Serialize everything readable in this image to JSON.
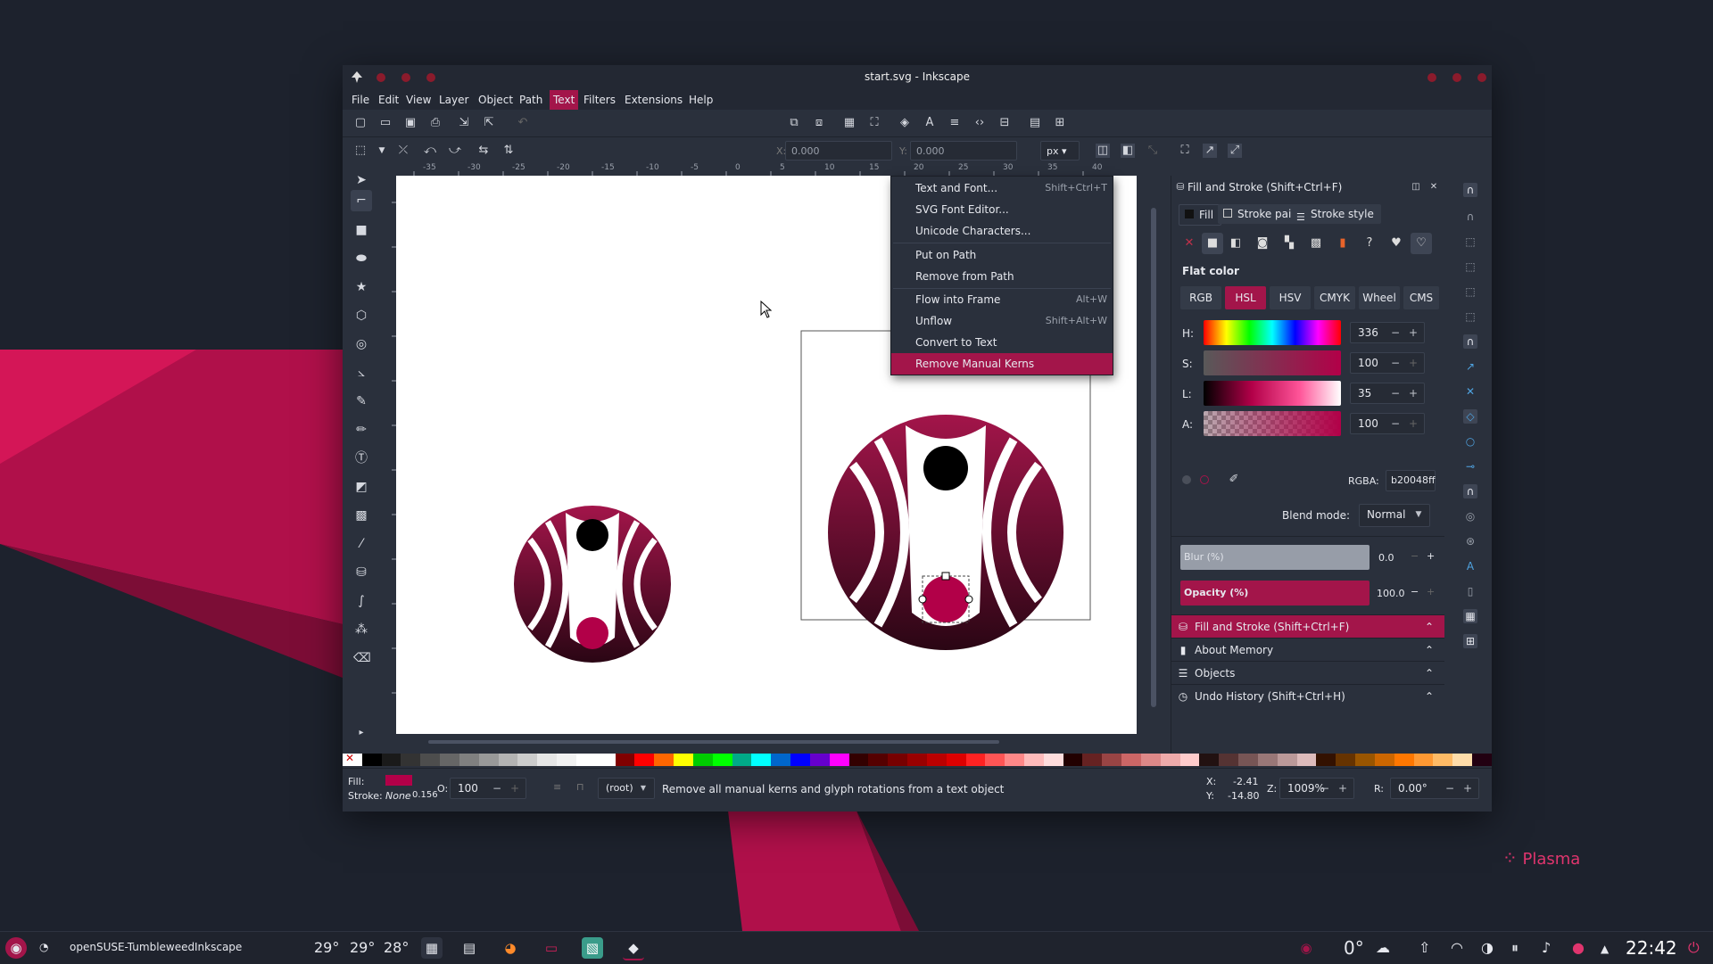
{
  "window": {
    "title": "start.svg - Inkscape"
  },
  "menubar": [
    "File",
    "Edit",
    "View",
    "Layer",
    "Object",
    "Path",
    "Text",
    "Filters",
    "Extensions",
    "Help"
  ],
  "active_menu": "Text",
  "text_menu": [
    {
      "label": "Text and Font...",
      "shortcut": "Shift+Ctrl+T"
    },
    {
      "label": "SVG Font Editor...",
      "shortcut": ""
    },
    {
      "label": "Unicode Characters...",
      "shortcut": ""
    },
    {
      "label": "Put on Path",
      "shortcut": ""
    },
    {
      "label": "Remove from Path",
      "shortcut": ""
    },
    {
      "label": "Flow into Frame",
      "shortcut": "Alt+W"
    },
    {
      "label": "Unflow",
      "shortcut": "Shift+Alt+W"
    },
    {
      "label": "Convert to Text",
      "shortcut": ""
    },
    {
      "label": "Remove Manual Kerns",
      "shortcut": ""
    }
  ],
  "toolbar2": {
    "x_label": "X:",
    "x_value": "0.000",
    "y_label": "Y:",
    "y_value": "0.000",
    "unit": "px"
  },
  "ruler_ticks": [
    "-35",
    "-30",
    "-25",
    "-20",
    "-15",
    "-10",
    "-5",
    "0",
    "5",
    "10",
    "15",
    "20",
    "25",
    "30",
    "35",
    "40"
  ],
  "panel": {
    "title": "Fill and Stroke (Shift+Ctrl+F)",
    "tabs": [
      "Fill",
      "Stroke paint",
      "Stroke style"
    ],
    "flat_color": "Flat color",
    "modes": [
      "RGB",
      "HSL",
      "HSV",
      "CMYK",
      "Wheel",
      "CMS"
    ],
    "active_mode": "HSL",
    "h_label": "H:",
    "h_value": "336",
    "s_label": "S:",
    "s_value": "100",
    "l_label": "L:",
    "l_value": "35",
    "a_label": "A:",
    "a_value": "100",
    "rgba_label": "RGBA:",
    "rgba_value": "b20048ff",
    "blend_label": "Blend mode:",
    "blend_value": "Normal",
    "blur_label": "Blur (%)",
    "blur_value": "0.0",
    "opacity_label": "Opacity (%)",
    "opacity_value": "100.0",
    "docked": [
      "Fill and Stroke (Shift+Ctrl+F)",
      "About Memory",
      "Objects",
      "Undo History (Shift+Ctrl+H)"
    ]
  },
  "colors": {
    "accent": "#a3154a",
    "fill": "#b20048"
  },
  "status": {
    "fill_label": "Fill:",
    "stroke_label": "Stroke:",
    "stroke_value": "None",
    "stroke_width": "0.156",
    "o_label": "O:",
    "opacity": "100",
    "layer": "(root)",
    "message": "Remove all manual kerns and glyph rotations from a text object",
    "x_label": "X:",
    "x_value": "-2.41",
    "y_label": "Y:",
    "y_value": "-14.80",
    "z_label": "Z:",
    "zoom": "1009%",
    "r_label": "R:",
    "rotation": "0.00°"
  },
  "taskbar": {
    "activity": "openSUSE-Tumbleweed",
    "app": "Inkscape",
    "temps": [
      "29°",
      "29°",
      "28°"
    ],
    "weather": "0°",
    "clock": "22:42"
  },
  "desktop_brand": "Plasma"
}
